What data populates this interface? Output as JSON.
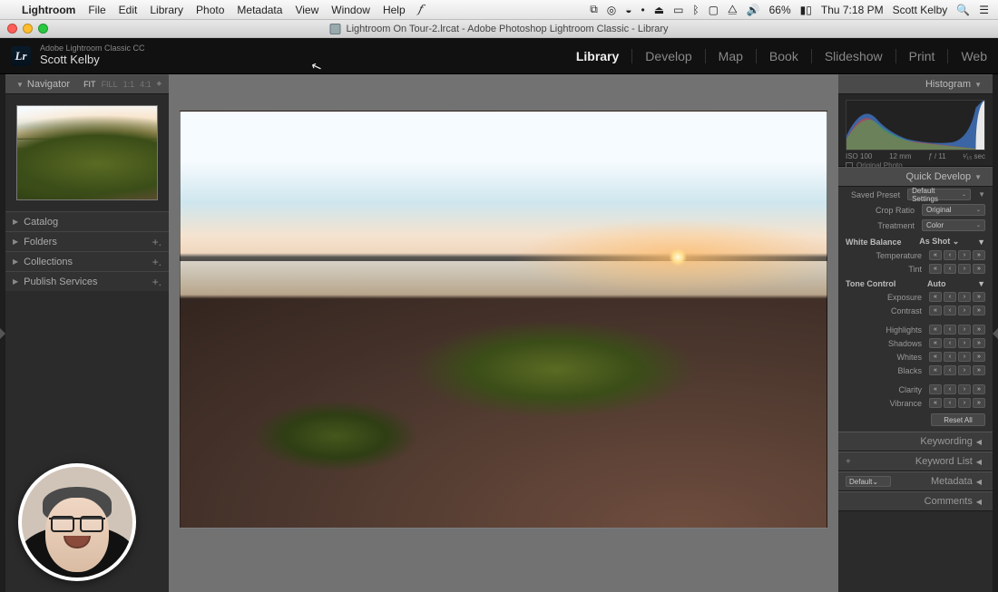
{
  "mac": {
    "app": "Lightroom",
    "menus": [
      "File",
      "Edit",
      "Library",
      "Photo",
      "Metadata",
      "View",
      "Window",
      "Help"
    ],
    "status": {
      "battery_pct": "66%",
      "clock": "Thu 7:18 PM",
      "user": "Scott Kelby"
    }
  },
  "window_title": "Lightroom On Tour-2.lrcat - Adobe Photoshop Lightroom Classic - Library",
  "identity": {
    "product": "Adobe Lightroom Classic CC",
    "owner": "Scott Kelby",
    "logo_text": "Lr"
  },
  "modules": [
    "Library",
    "Develop",
    "Map",
    "Book",
    "Slideshow",
    "Print",
    "Web"
  ],
  "active_module": "Library",
  "navigator": {
    "title": "Navigator",
    "zoom_levels": [
      "FIT",
      "FILL",
      "1:1",
      "4:1"
    ],
    "zoom_active": "FIT"
  },
  "left_sections": [
    {
      "label": "Catalog",
      "has_add": false
    },
    {
      "label": "Folders",
      "has_add": true
    },
    {
      "label": "Collections",
      "has_add": true
    },
    {
      "label": "Publish Services",
      "has_add": true
    }
  ],
  "histogram": {
    "title": "Histogram",
    "iso": "ISO 100",
    "focal": "12 mm",
    "aperture": "ƒ / 11",
    "shutter": "¹⁄₁₅ sec",
    "original_photo_label": "Original Photo"
  },
  "quick_develop": {
    "title": "Quick Develop",
    "saved_preset": {
      "label": "Saved Preset",
      "value": "Default Settings"
    },
    "crop_ratio": {
      "label": "Crop Ratio",
      "value": "Original"
    },
    "treatment": {
      "label": "Treatment",
      "value": "Color"
    },
    "white_balance": {
      "label": "White Balance",
      "value": "As Shot"
    },
    "temp_label": "Temperature",
    "tint_label": "Tint",
    "tone_control": {
      "label": "Tone Control",
      "auto": "Auto"
    },
    "tone_rows": [
      "Exposure",
      "Contrast",
      "Highlights",
      "Shadows",
      "Whites",
      "Blacks",
      "Clarity",
      "Vibrance"
    ],
    "reset_label": "Reset All"
  },
  "right_collapsed": {
    "keywording": "Keywording",
    "keyword_list": "Keyword List",
    "metadata": "Metadata",
    "metadata_preset": "Default",
    "comments": "Comments"
  }
}
